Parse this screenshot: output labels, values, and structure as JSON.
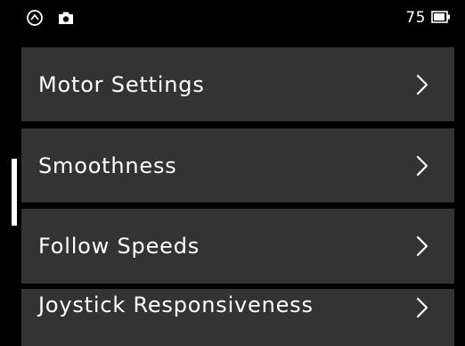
{
  "status_bar": {
    "mode_icon": "mode-dial-icon",
    "camera_icon": "camera-icon",
    "battery_level": "75",
    "battery_icon": "battery-icon"
  },
  "menu": {
    "items": [
      {
        "label": "Motor Settings"
      },
      {
        "label": "Smoothness"
      },
      {
        "label": "Follow Speeds"
      },
      {
        "label": "Joystick Responsiveness"
      }
    ],
    "chevron_icon": "chevron-right-icon"
  },
  "colors": {
    "background": "#000000",
    "item_background": "#333333",
    "text": "#ffffff"
  }
}
